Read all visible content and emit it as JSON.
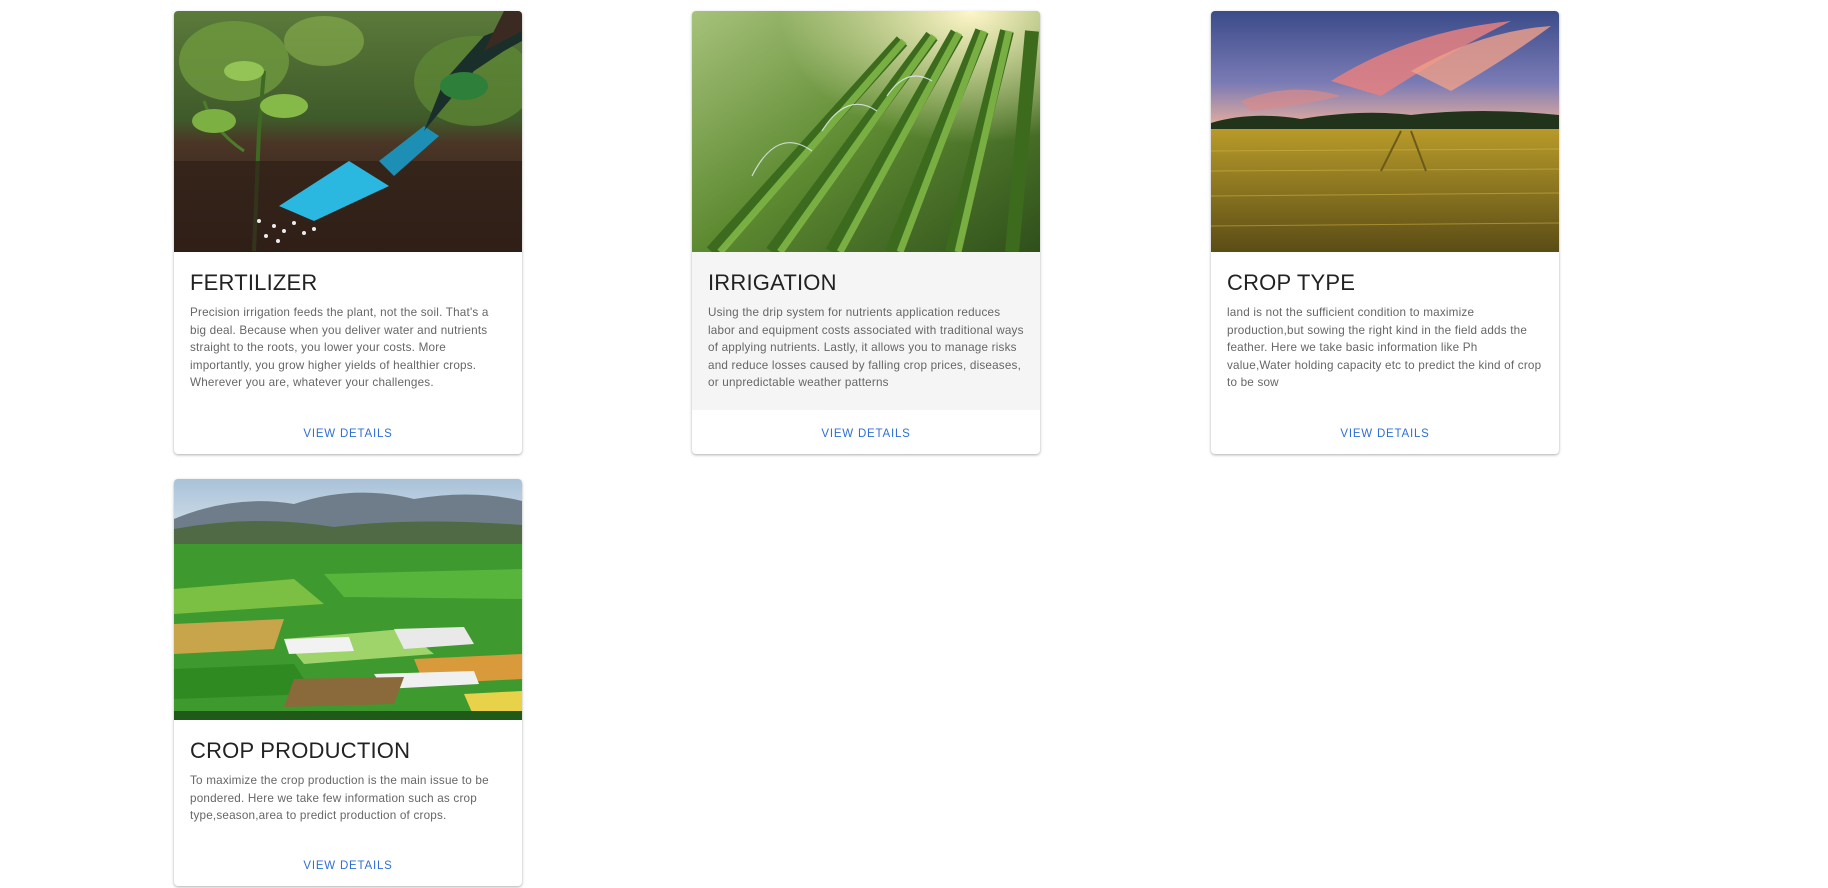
{
  "cards": [
    {
      "title": "FERTILIZER",
      "description": "Precision irrigation feeds the plant, not the soil. That's a big deal. Because when you deliver water and nutrients straight to the roots, you lower your costs. More importantly, you grow higher yields of healthier crops. Wherever you are, whatever your challenges.",
      "button": "VIEW DETAILS"
    },
    {
      "title": "IRRIGATION",
      "description": "Using the drip system for nutrients application reduces labor and equipment costs associated with traditional ways of applying nutrients. Lastly, it allows you to manage risks and reduce losses caused by falling crop prices, diseases, or unpredictable weather patterns",
      "button": "VIEW DETAILS"
    },
    {
      "title": "CROP TYPE",
      "description": "land is not the sufficient condition to maximize production,but sowing the right kind in the field adds the feather. Here we take basic information like Ph value,Water holding capacity etc to predict the kind of crop to be sow",
      "button": "VIEW DETAILS"
    },
    {
      "title": "CROP PRODUCTION",
      "description": "To maximize the crop production is the main issue to be pondered. Here we take few information such as crop type,season,area to predict production of crops.",
      "button": "VIEW DETAILS"
    }
  ],
  "colors": {
    "accent": "#2f6fd6",
    "title_text": "#222222",
    "body_text": "#666666",
    "hover_background": "#f5f5f5"
  }
}
